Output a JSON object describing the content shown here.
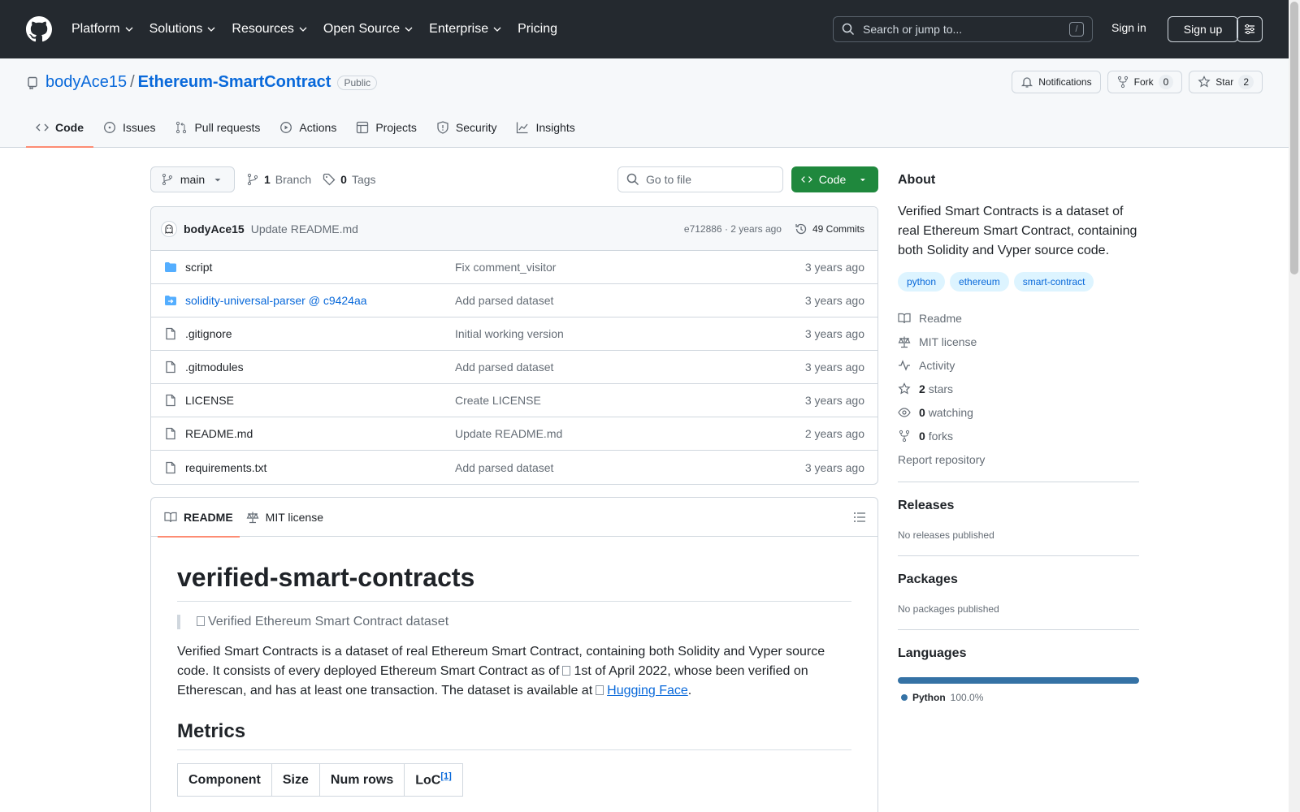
{
  "header": {
    "nav": [
      "Platform",
      "Solutions",
      "Resources",
      "Open Source",
      "Enterprise",
      "Pricing"
    ],
    "search_placeholder": "Search or jump to...",
    "search_shortcut": "/",
    "sign_in": "Sign in",
    "sign_up": "Sign up"
  },
  "repo": {
    "owner": "bodyAce15",
    "separator": "/",
    "name": "Ethereum-SmartContract",
    "visibility": "Public",
    "actions": {
      "notifications": "Notifications",
      "fork": "Fork",
      "fork_count": "0",
      "star": "Star",
      "star_count": "2"
    },
    "tabs": [
      "Code",
      "Issues",
      "Pull requests",
      "Actions",
      "Projects",
      "Security",
      "Insights"
    ]
  },
  "toolbar": {
    "branch": "main",
    "branch_count": "1",
    "branch_label": "Branch",
    "tag_count": "0",
    "tag_label": "Tags",
    "goto_placeholder": "Go to file",
    "code_button": "Code"
  },
  "commit": {
    "author": "bodyAce15",
    "message": "Update README.md",
    "hash_time": "e712886 · 2 years ago",
    "count": "49 Commits"
  },
  "files": [
    {
      "name": "script",
      "type": "folder",
      "message": "Fix comment_visitor",
      "age": "3 years ago"
    },
    {
      "name": "solidity-universal-parser @ c9424aa",
      "type": "submodule",
      "message": "Add parsed dataset",
      "age": "3 years ago"
    },
    {
      "name": ".gitignore",
      "type": "file",
      "message": "Initial working version",
      "age": "3 years ago"
    },
    {
      "name": ".gitmodules",
      "type": "file",
      "message": "Add parsed dataset",
      "age": "3 years ago"
    },
    {
      "name": "LICENSE",
      "type": "file",
      "message": "Create LICENSE",
      "age": "3 years ago"
    },
    {
      "name": "README.md",
      "type": "file",
      "message": "Update README.md",
      "age": "2 years ago"
    },
    {
      "name": "requirements.txt",
      "type": "file",
      "message": "Add parsed dataset",
      "age": "3 years ago"
    }
  ],
  "readme": {
    "tab_readme": "README",
    "tab_license": "MIT license",
    "title": "verified-smart-contracts",
    "quote": "Verified Ethereum Smart Contract dataset",
    "para_1": "Verified Smart Contracts is a dataset of real Ethereum Smart Contract, containing both Solidity and Vyper source code. It consists of every deployed Ethereum Smart Contract as of",
    "para_2": "1st of April 2022, whose been verified on Etherescan, and has at least one transaction. The dataset is available at",
    "link": "Hugging Face",
    "para_end": ".",
    "metrics_heading": "Metrics",
    "table_headers": [
      "Component",
      "Size",
      "Num rows",
      "LoC"
    ],
    "loc_footnote": "[1]"
  },
  "about": {
    "heading": "About",
    "description": "Verified Smart Contracts is a dataset of real Ethereum Smart Contract, containing both Solidity and Vyper source code.",
    "topics": [
      "python",
      "ethereum",
      "smart-contract"
    ],
    "links": {
      "readme": "Readme",
      "license": "MIT license",
      "activity": "Activity",
      "stars_count": "2",
      "stars_label": "stars",
      "watching_count": "0",
      "watching_label": "watching",
      "forks_count": "0",
      "forks_label": "forks",
      "report": "Report repository"
    }
  },
  "releases": {
    "heading": "Releases",
    "text": "No releases published"
  },
  "packages": {
    "heading": "Packages",
    "text": "No packages published"
  },
  "languages": {
    "heading": "Languages",
    "name": "Python",
    "percent": "100.0%",
    "color": "#3572a5"
  }
}
